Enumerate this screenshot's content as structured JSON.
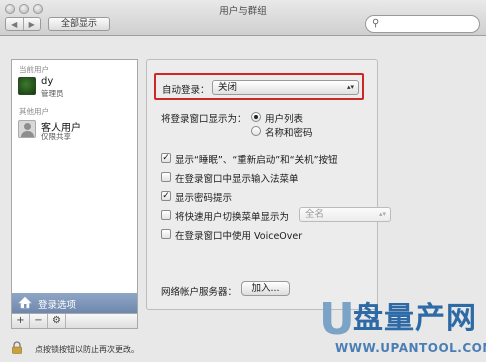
{
  "window": {
    "title": "用户与群组"
  },
  "toolbar": {
    "back_glyph": "◀",
    "forward_glyph": "▶",
    "show_all_label": "全部显示",
    "search_placeholder": ""
  },
  "sidebar": {
    "current_users_label": "当前用户",
    "current_user": {
      "name": "dy",
      "role": "管理员"
    },
    "other_users_label": "其他用户",
    "guest_user": {
      "name": "客人用户",
      "role": "仅限共享"
    },
    "login_options_label": "登录选项",
    "tools": {
      "add": "+",
      "remove": "−",
      "gear": "⚙"
    }
  },
  "login_panel": {
    "auto_login": {
      "label": "自动登录：",
      "value": "关闭"
    },
    "display_as": {
      "label": "将登录窗口显示为：",
      "options": [
        "用户列表",
        "名称和密码"
      ],
      "selected_index": 0
    },
    "checkboxes": [
      {
        "label": "显示“睡眠”、“重新启动”和“关机”按钮",
        "checked": true
      },
      {
        "label": "在登录窗口中显示输入法菜单",
        "checked": false
      },
      {
        "label": "显示密码提示",
        "checked": true
      },
      {
        "label": "将快速用户切换菜单显示为",
        "checked": false
      },
      {
        "label": "在登录窗口中使用 VoiceOver",
        "checked": false
      }
    ],
    "fast_switch_popup": {
      "value": "全名"
    },
    "network_server": {
      "label": "网络帐户服务器：",
      "button": "加入..."
    }
  },
  "footer": {
    "lock_text": "点按锁按钮以防止再次更改。"
  },
  "watermark": {
    "mark": "U",
    "name": "盘量产网",
    "url": "WWW.UPANTOOL.COM"
  },
  "colors": {
    "highlight_border": "#cf2626",
    "selection": "#7b93b8",
    "watermark_blue": "#2d6aa6"
  }
}
